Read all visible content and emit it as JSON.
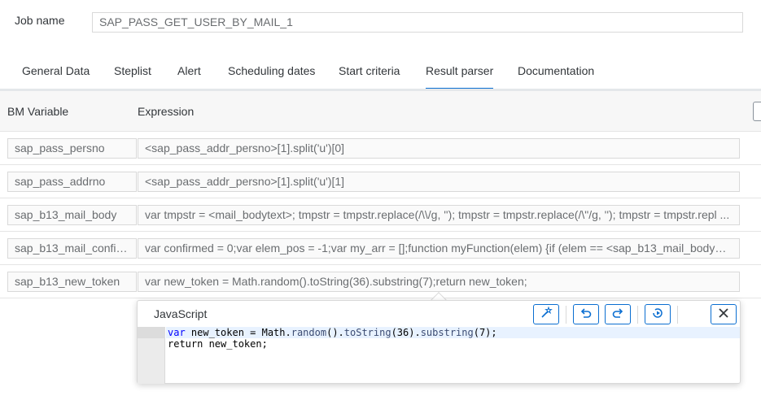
{
  "job": {
    "label": "Job name",
    "value": "SAP_PASS_GET_USER_BY_MAIL_1"
  },
  "tabs": [
    {
      "label": "General Data"
    },
    {
      "label": "Steplist"
    },
    {
      "label": "Alert"
    },
    {
      "label": "Scheduling dates"
    },
    {
      "label": "Start criteria"
    },
    {
      "label": "Result parser",
      "active": true
    },
    {
      "label": "Documentation"
    }
  ],
  "table": {
    "headers": {
      "variable": "BM Variable",
      "expression": "Expression"
    },
    "rows": [
      {
        "variable": "sap_pass_persno",
        "expression": "<sap_pass_addr_persno>[1].split('u')[0]"
      },
      {
        "variable": "sap_pass_addrno",
        "expression": "<sap_pass_addr_persno>[1].split('u')[1]"
      },
      {
        "variable": "sap_b13_mail_body",
        "expression": "var tmpstr = <mail_bodytext>; tmpstr = tmpstr.replace(/\\\\/g, ''); tmpstr = tmpstr.replace(/\\\"/g, ''); tmpstr = tmpstr.repl ..."
      },
      {
        "variable": "sap_b13_mail_confir ...",
        "expression": "var confirmed = 0;var elem_pos = -1;var my_arr = [];function myFunction(elem) {if (elem == <sap_b13_mail_body> ..."
      },
      {
        "variable": "sap_b13_new_token",
        "expression": "var new_token = Math.random().toString(36).substring(7);return new_token;"
      }
    ]
  },
  "editor": {
    "title": "JavaScript",
    "buttons": {
      "beautify": "magic-wand-icon",
      "undo": "undo-icon",
      "redo": "redo-icon",
      "run": "run-icon",
      "close": "close-icon"
    },
    "lines": {
      "line1_kw": "var",
      "line1_a": " new_token = Math.",
      "line1_fn1": "random",
      "line1_b": "().",
      "line1_fn2": "toString",
      "line1_c": "(36).",
      "line1_fn3": "substring",
      "line1_d": "(7);",
      "line2": "return new_token;"
    }
  },
  "colors": {
    "accent": "#0a6ed1",
    "keyword": "#0000ff"
  }
}
